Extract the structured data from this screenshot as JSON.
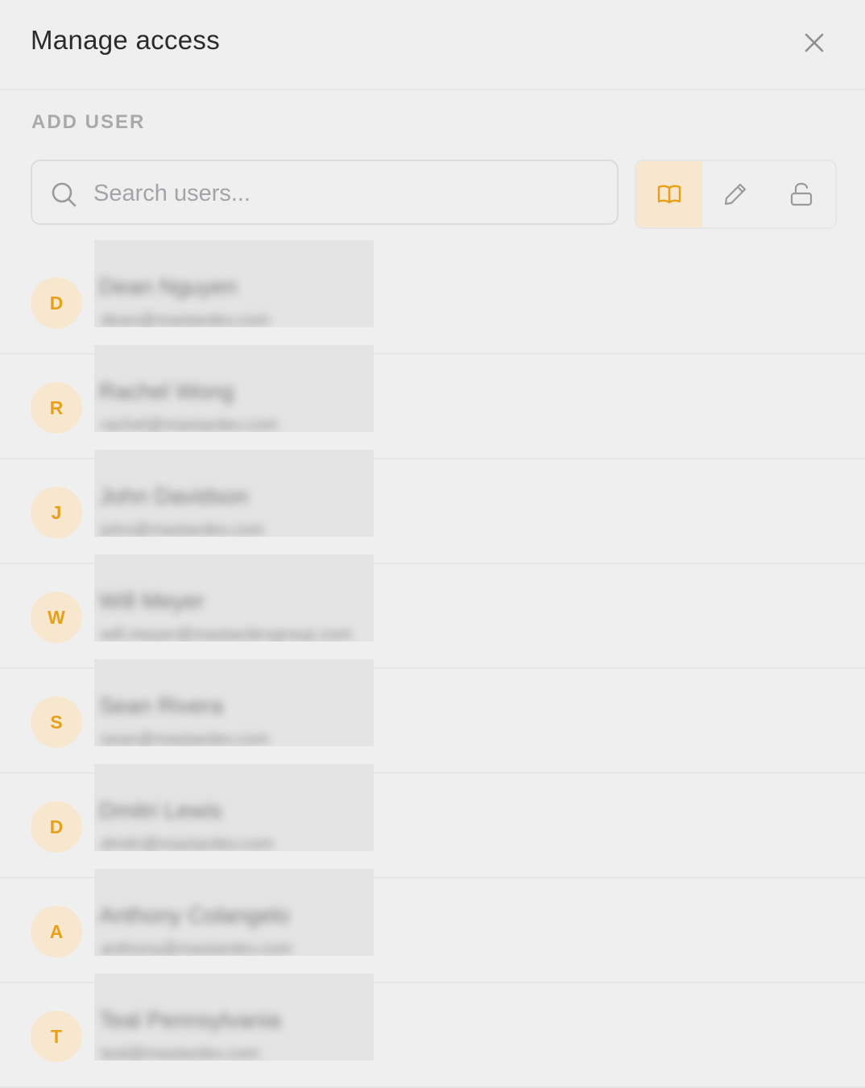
{
  "header": {
    "title": "Manage access"
  },
  "add_user": {
    "section_label": "ADD USER",
    "search_placeholder": "Search users...",
    "search_value": ""
  },
  "permissions": [
    {
      "name": "read",
      "icon": "book-icon",
      "active": true
    },
    {
      "name": "edit",
      "icon": "pencil-icon",
      "active": false
    },
    {
      "name": "admin",
      "icon": "unlock-icon",
      "active": false
    }
  ],
  "colors": {
    "accent": "#e6a01a",
    "accent_bg": "#f8e7cf",
    "background": "#efefef"
  },
  "users": [
    {
      "initial": "D",
      "name": "Dean Nguyen",
      "email": "dean@mastardev.com"
    },
    {
      "initial": "R",
      "name": "Rachel Wong",
      "email": "rachel@mastardev.com"
    },
    {
      "initial": "J",
      "name": "John Davidson",
      "email": "john@mastardev.com"
    },
    {
      "initial": "W",
      "name": "Will Meyer",
      "email": "will.meyer@mastardevgroup.com"
    },
    {
      "initial": "S",
      "name": "Sean Rivera",
      "email": "sean@mastardev.com"
    },
    {
      "initial": "D",
      "name": "Dmitri Lewis",
      "email": "dmitri@mastardev.com"
    },
    {
      "initial": "A",
      "name": "Anthony Colangelo",
      "email": "anthony@mastardev.com"
    },
    {
      "initial": "T",
      "name": "Teal Pennsylvania",
      "email": "teal@mastardev.com"
    }
  ]
}
